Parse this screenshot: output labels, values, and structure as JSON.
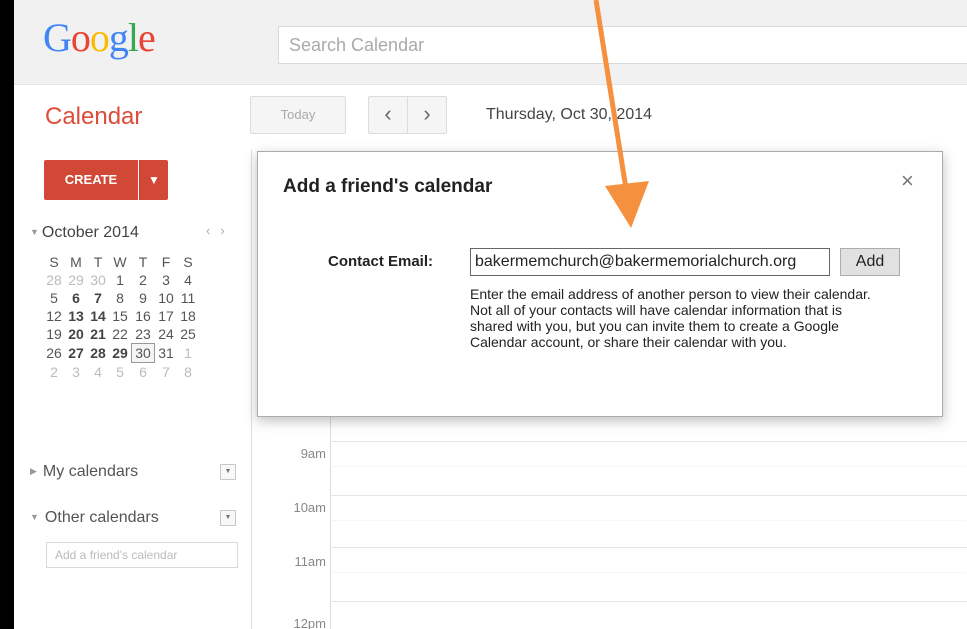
{
  "header": {
    "logo_letters": [
      "G",
      "o",
      "o",
      "g",
      "l",
      "e"
    ],
    "logo_colors": [
      "#4285f4",
      "#ea4335",
      "#fbbc05",
      "#4285f4",
      "#34a853",
      "#ea4335"
    ],
    "search_placeholder": "Search Calendar"
  },
  "toolbar": {
    "app_title": "Calendar",
    "today_label": "Today",
    "prev_label": "‹",
    "next_label": "›",
    "current_date": "Thursday, Oct 30, 2014"
  },
  "sidebar": {
    "create_label": "CREATE",
    "create_dropdown_label": "▼",
    "mini_calendar": {
      "month_label": "October 2014",
      "weekdays": [
        "S",
        "M",
        "T",
        "W",
        "T",
        "F",
        "S"
      ],
      "weeks": [
        [
          {
            "d": "28",
            "dim": true
          },
          {
            "d": "29",
            "dim": true
          },
          {
            "d": "30",
            "dim": true
          },
          {
            "d": "1"
          },
          {
            "d": "2"
          },
          {
            "d": "3"
          },
          {
            "d": "4"
          }
        ],
        [
          {
            "d": "5"
          },
          {
            "d": "6",
            "bold": true
          },
          {
            "d": "7",
            "bold": true
          },
          {
            "d": "8"
          },
          {
            "d": "9"
          },
          {
            "d": "10"
          },
          {
            "d": "11"
          }
        ],
        [
          {
            "d": "12"
          },
          {
            "d": "13",
            "bold": true
          },
          {
            "d": "14",
            "bold": true
          },
          {
            "d": "15"
          },
          {
            "d": "16"
          },
          {
            "d": "17"
          },
          {
            "d": "18"
          }
        ],
        [
          {
            "d": "19"
          },
          {
            "d": "20",
            "bold": true
          },
          {
            "d": "21",
            "bold": true
          },
          {
            "d": "22"
          },
          {
            "d": "23"
          },
          {
            "d": "24"
          },
          {
            "d": "25"
          }
        ],
        [
          {
            "d": "26"
          },
          {
            "d": "27",
            "bold": true
          },
          {
            "d": "28",
            "bold": true
          },
          {
            "d": "29",
            "bold": true
          },
          {
            "d": "30",
            "selected": true
          },
          {
            "d": "31"
          },
          {
            "d": "1",
            "dim": true
          }
        ],
        [
          {
            "d": "2",
            "dim": true
          },
          {
            "d": "3",
            "dim": true
          },
          {
            "d": "4",
            "dim": true
          },
          {
            "d": "5",
            "dim": true
          },
          {
            "d": "6",
            "dim": true
          },
          {
            "d": "7",
            "dim": true
          },
          {
            "d": "8",
            "dim": true
          }
        ]
      ]
    },
    "my_calendars_label": "My calendars",
    "other_calendars_label": "Other calendars",
    "add_friend_placeholder": "Add a friend's calendar"
  },
  "day_view": {
    "hours": [
      {
        "label": "9am"
      },
      {
        "label": "10am"
      },
      {
        "label": "11am"
      },
      {
        "label": "12pm"
      }
    ]
  },
  "dialog": {
    "title": "Add a friend's calendar",
    "close_label": "×",
    "email_label": "Contact Email:",
    "email_value": "bakermemchurch@bakermemorialchurch.org",
    "add_label": "Add",
    "help_text": "Enter the email address of another person to view their calendar. Not all of your contacts will have calendar information that is shared with you, but you can invite them to create a Google Calendar account, or share their calendar with you."
  },
  "annotation": {
    "arrow_color": "#f5913e"
  }
}
